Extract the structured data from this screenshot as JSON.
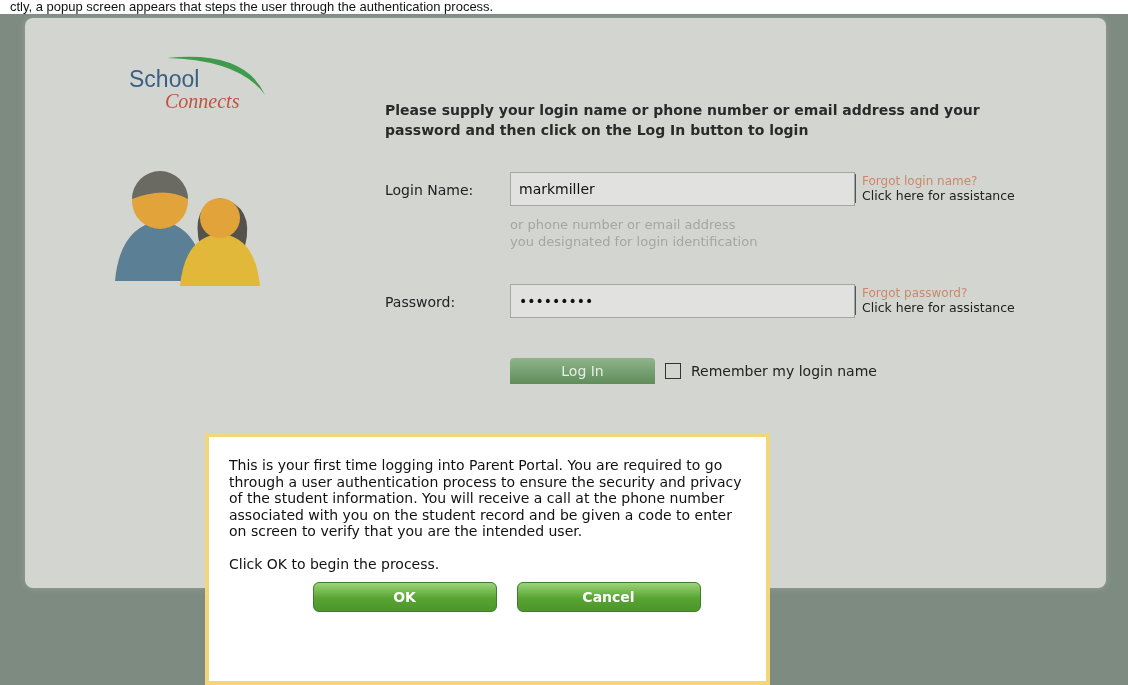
{
  "caption": "ctly, a popup screen appears that steps the user through the authentication process.",
  "logo": {
    "word_1": "School",
    "word_2": "Connects"
  },
  "instructions": "Please supply your login name or phone number or email address and your password and then click on the Log In button to login",
  "fields": [
    {
      "label": "Login Name:",
      "value": "markmiller",
      "hint": "or phone number or email address\nyou designated for login identification",
      "help_title": "Forgot login name?",
      "help_link": "Click here for assistance"
    },
    {
      "label": "Password:",
      "value": "•••••••••",
      "help_title": "Forgot password?",
      "help_link": "Click here for assistance"
    }
  ],
  "login_button": "Log In",
  "remember": {
    "label": "Remember my login name",
    "checked": false
  },
  "dialog": {
    "message": "This is your first time logging into Parent Portal. You are required to go through a user authentication process to ensure the security and privacy of the student information. You will receive a call at the phone number associated with you on the student record and be given a code to enter on screen to verify that you are the intended user.",
    "prompt": "Click OK to begin the process.",
    "buttons": [
      "OK",
      "Cancel"
    ]
  }
}
